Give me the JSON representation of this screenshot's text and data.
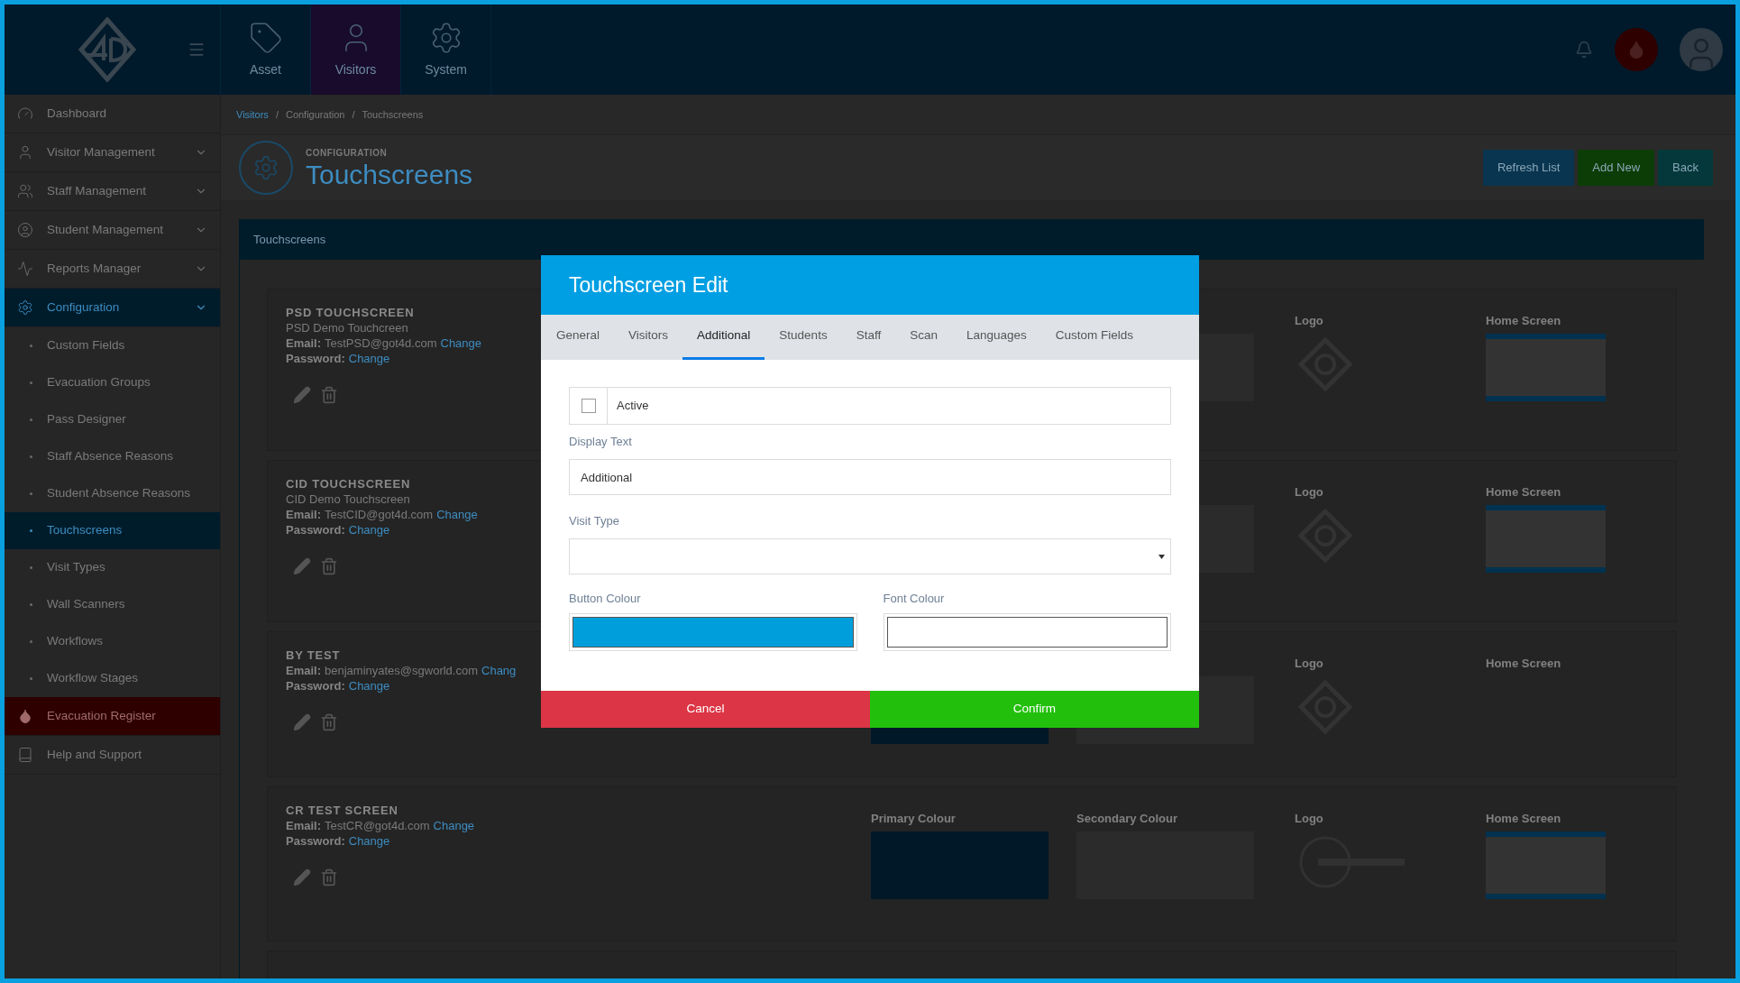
{
  "header": {
    "nav": [
      {
        "label": "Asset",
        "kind": "tag",
        "selected": false
      },
      {
        "label": "Visitors",
        "kind": "user",
        "selected": true
      },
      {
        "label": "System",
        "kind": "gear",
        "selected": false
      }
    ]
  },
  "sidebar": {
    "items": [
      {
        "label": "Dashboard",
        "kind": "main",
        "selected": false
      },
      {
        "label": "Visitor Management",
        "kind": "group",
        "selected": false
      },
      {
        "label": "Staff Management",
        "kind": "group",
        "selected": false
      },
      {
        "label": "Student Management",
        "kind": "group",
        "selected": false
      },
      {
        "label": "Reports Manager",
        "kind": "group",
        "selected": false
      },
      {
        "label": "Configuration",
        "kind": "group",
        "selected": true
      },
      {
        "label": "Custom Fields",
        "kind": "sub",
        "selected": false
      },
      {
        "label": "Evacuation Groups",
        "kind": "sub",
        "selected": false
      },
      {
        "label": "Pass Designer",
        "kind": "sub",
        "selected": false
      },
      {
        "label": "Staff Absence Reasons",
        "kind": "sub",
        "selected": false
      },
      {
        "label": "Student Absence Reasons",
        "kind": "sub",
        "selected": false
      },
      {
        "label": "Touchscreens",
        "kind": "sub",
        "selected": true
      },
      {
        "label": "Visit Types",
        "kind": "sub",
        "selected": false
      },
      {
        "label": "Wall Scanners",
        "kind": "sub",
        "selected": false
      },
      {
        "label": "Workflows",
        "kind": "sub",
        "selected": false
      },
      {
        "label": "Workflow Stages",
        "kind": "sub",
        "selected": false
      },
      {
        "label": "Evacuation Register",
        "kind": "alert",
        "selected": false
      },
      {
        "label": "Help and Support",
        "kind": "main",
        "selected": false
      }
    ]
  },
  "breadcrumb": {
    "items": [
      "Visitors",
      "Configuration",
      "Touchscreens"
    ],
    "separator": "/"
  },
  "page_header": {
    "overline": "CONFIGURATION",
    "title": "Touchscreens"
  },
  "actions": [
    {
      "label": "Refresh List",
      "kind": "refresh"
    },
    {
      "label": "Add New",
      "kind": "add"
    },
    {
      "label": "Back",
      "kind": "back"
    }
  ],
  "panel": {
    "title": "Touchscreens"
  },
  "cards": [
    {
      "name": "PSD TOUCHSCREEN",
      "description": "PSD Demo Touchcreen",
      "email_label": "Email:",
      "email": "TestPSD@got4d.com",
      "email_link": "Change",
      "password_label": "Password:",
      "password_link": "Change",
      "logo_label": "Logo",
      "home_label": "Home Screen",
      "kind": "diamond",
      "home_image": true
    },
    {
      "name": "CID TOUCHSCREEN",
      "description": "CID Demo Touchscreen",
      "email_label": "Email:",
      "email": "TestCID@got4d.com",
      "email_link": "Change",
      "password_label": "Password:",
      "password_link": "Change",
      "logo_label": "Logo",
      "home_label": "Home Screen",
      "kind": "diamond",
      "home_image": true
    },
    {
      "name": "BY TEST",
      "email_label": "Email:",
      "email": "benjaminyates@sgworld.com",
      "email_link": "Chang",
      "password_label": "Password:",
      "password_link": "Change",
      "logo_label": "Logo",
      "home_label": "Home Screen",
      "kind": "diamond",
      "home_image": false
    },
    {
      "name": "CR TEST SCREEN",
      "email_label": "Email:",
      "email": "TestCR@got4d.com",
      "email_link": "Change",
      "password_label": "Password:",
      "password_link": "Change",
      "primary_label": "Primary Colour",
      "secondary_label": "Secondary Colour",
      "logo_label": "Logo",
      "home_label": "Home Screen",
      "kind": "circle",
      "home_image": true
    }
  ],
  "modal": {
    "title": "Touchscreen Edit",
    "tabs": [
      {
        "label": "General",
        "selected": false
      },
      {
        "label": "Visitors",
        "selected": false
      },
      {
        "label": "Additional",
        "selected": true
      },
      {
        "label": "Students",
        "selected": false
      },
      {
        "label": "Staff",
        "selected": false
      },
      {
        "label": "Scan",
        "selected": false
      },
      {
        "label": "Languages",
        "selected": false
      },
      {
        "label": "Custom Fields",
        "selected": false
      }
    ],
    "active": {
      "label": "Active",
      "checked": false
    },
    "display_text": {
      "label": "Display Text",
      "value": "Additional"
    },
    "visit_type": {
      "label": "Visit Type"
    },
    "colours": [
      {
        "label": "Button Colour",
        "color": "#009fdb"
      },
      {
        "label": "Font Colour",
        "color": "#ffffff"
      }
    ],
    "buttons": [
      {
        "label": "Cancel",
        "kind": "cancel"
      },
      {
        "label": "Confirm",
        "kind": "confirm"
      }
    ]
  }
}
